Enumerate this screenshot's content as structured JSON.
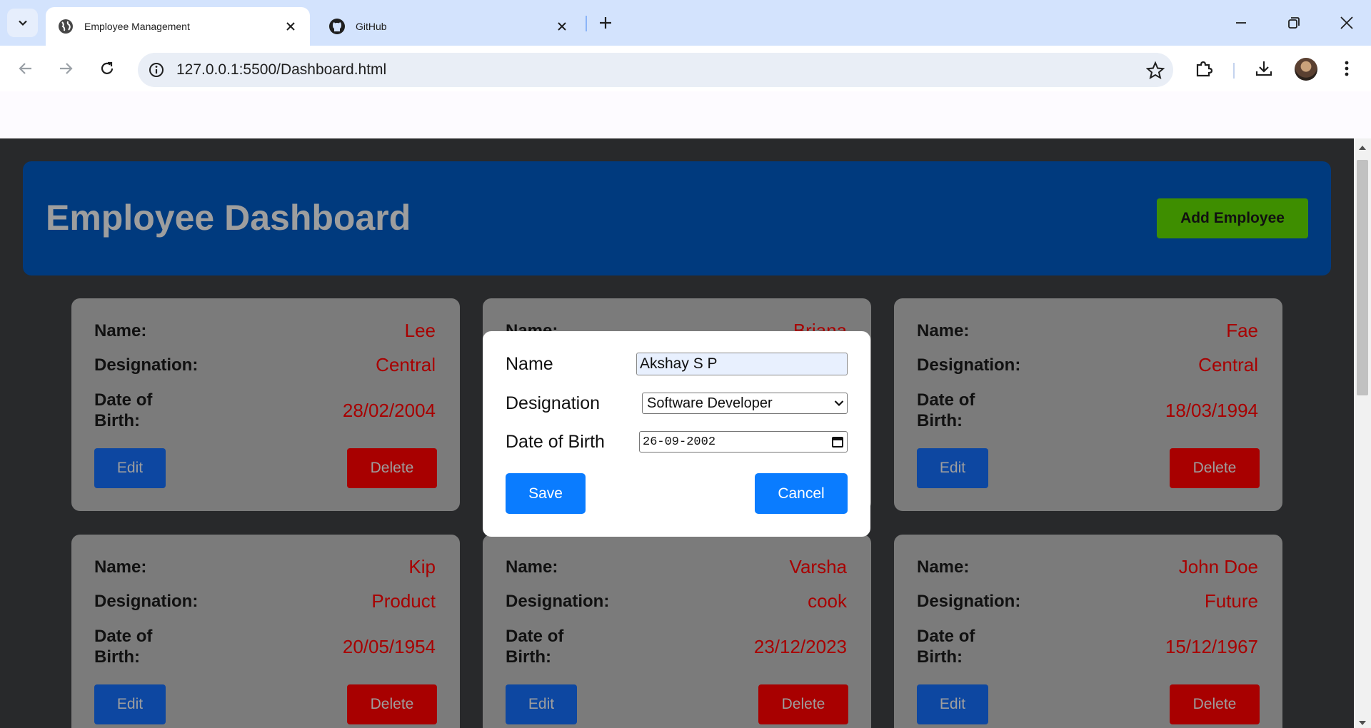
{
  "browser": {
    "tabs": [
      {
        "title": "Employee Management",
        "icon": "globe-icon",
        "active": true
      },
      {
        "title": "GitHub",
        "icon": "github-icon",
        "active": false
      }
    ],
    "url": "127.0.0.1:5500/Dashboard.html"
  },
  "page": {
    "title": "Employee Dashboard",
    "add_button": "Add Employee",
    "labels": {
      "name": "Name:",
      "designation": "Designation:",
      "dob": "Date of Birth:"
    },
    "edit_label": "Edit",
    "delete_label": "Delete",
    "employees": [
      {
        "name": "Lee",
        "designation": "Central",
        "dob": "28/02/2004"
      },
      {
        "name": "Briana",
        "designation": "",
        "dob": ""
      },
      {
        "name": "Fae",
        "designation": "Central",
        "dob": "18/03/1994"
      },
      {
        "name": "Kip",
        "designation": "Product",
        "dob": "20/05/1954"
      },
      {
        "name": "Varsha",
        "designation": "cook",
        "dob": "23/12/2023"
      },
      {
        "name": "John Doe",
        "designation": "Future",
        "dob": "15/12/1967"
      }
    ]
  },
  "modal": {
    "name_label": "Name",
    "name_value": "Akshay S P",
    "designation_label": "Designation",
    "designation_value": "Software Developer",
    "dob_label": "Date of Birth",
    "dob_value": "26-09-2002",
    "save_label": "Save",
    "cancel_label": "Cancel"
  },
  "colors": {
    "header_bg": "#003a7e",
    "add_button": "#3e8e00",
    "card_bg": "#7b7b7b",
    "value_text": "#a80000",
    "edit_button": "#0d47a1",
    "delete_button": "#a80000",
    "modal_button": "#0a7cff"
  }
}
